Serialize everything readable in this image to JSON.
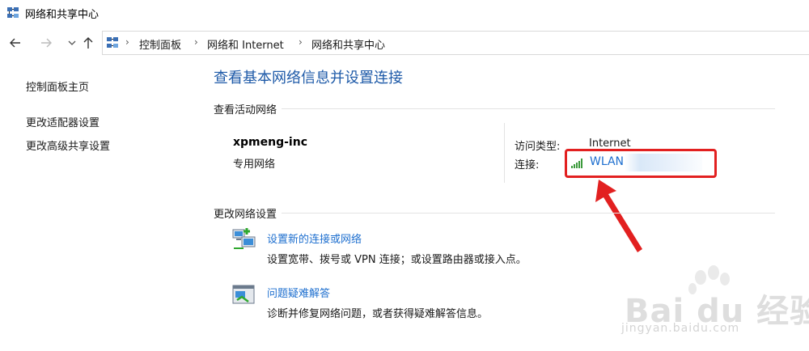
{
  "window": {
    "title": "网络和共享中心"
  },
  "nav": {
    "back_icon": "arrow-left-icon",
    "forward_icon": "arrow-right-icon",
    "recent_icon": "chevron-down-icon",
    "up_icon": "arrow-up-icon",
    "breadcrumbs": [
      "控制面板",
      "网络和 Internet",
      "网络和共享中心"
    ],
    "separator": "›"
  },
  "sidebar": {
    "items": [
      {
        "label": "控制面板主页"
      },
      {
        "label": "更改适配器设置"
      },
      {
        "label": "更改高级共享设置"
      }
    ]
  },
  "main": {
    "heading": "查看基本网络信息并设置连接",
    "active_section_title": "查看活动网络",
    "network": {
      "name": "xpmeng-inc",
      "type": "专用网络",
      "access_label": "访问类型:",
      "access_value": "Internet",
      "connection_label": "连接:",
      "connection_value": "WLAN"
    },
    "change_section_title": "更改网络设置",
    "tasks": [
      {
        "link": "设置新的连接或网络",
        "desc": "设置宽带、拨号或 VPN 连接；或设置路由器或接入点。",
        "icon": "new-connection-icon"
      },
      {
        "link": "问题疑难解答",
        "desc": "诊断并修复网络问题，或者获得疑难解答信息。",
        "icon": "troubleshoot-icon"
      }
    ]
  },
  "watermark": {
    "text": "Bai du 经验",
    "url": "jingyan.baidu.com"
  },
  "colors": {
    "heading": "#1e5aa8",
    "link": "#1e6fcf",
    "highlight": "#e22020"
  }
}
